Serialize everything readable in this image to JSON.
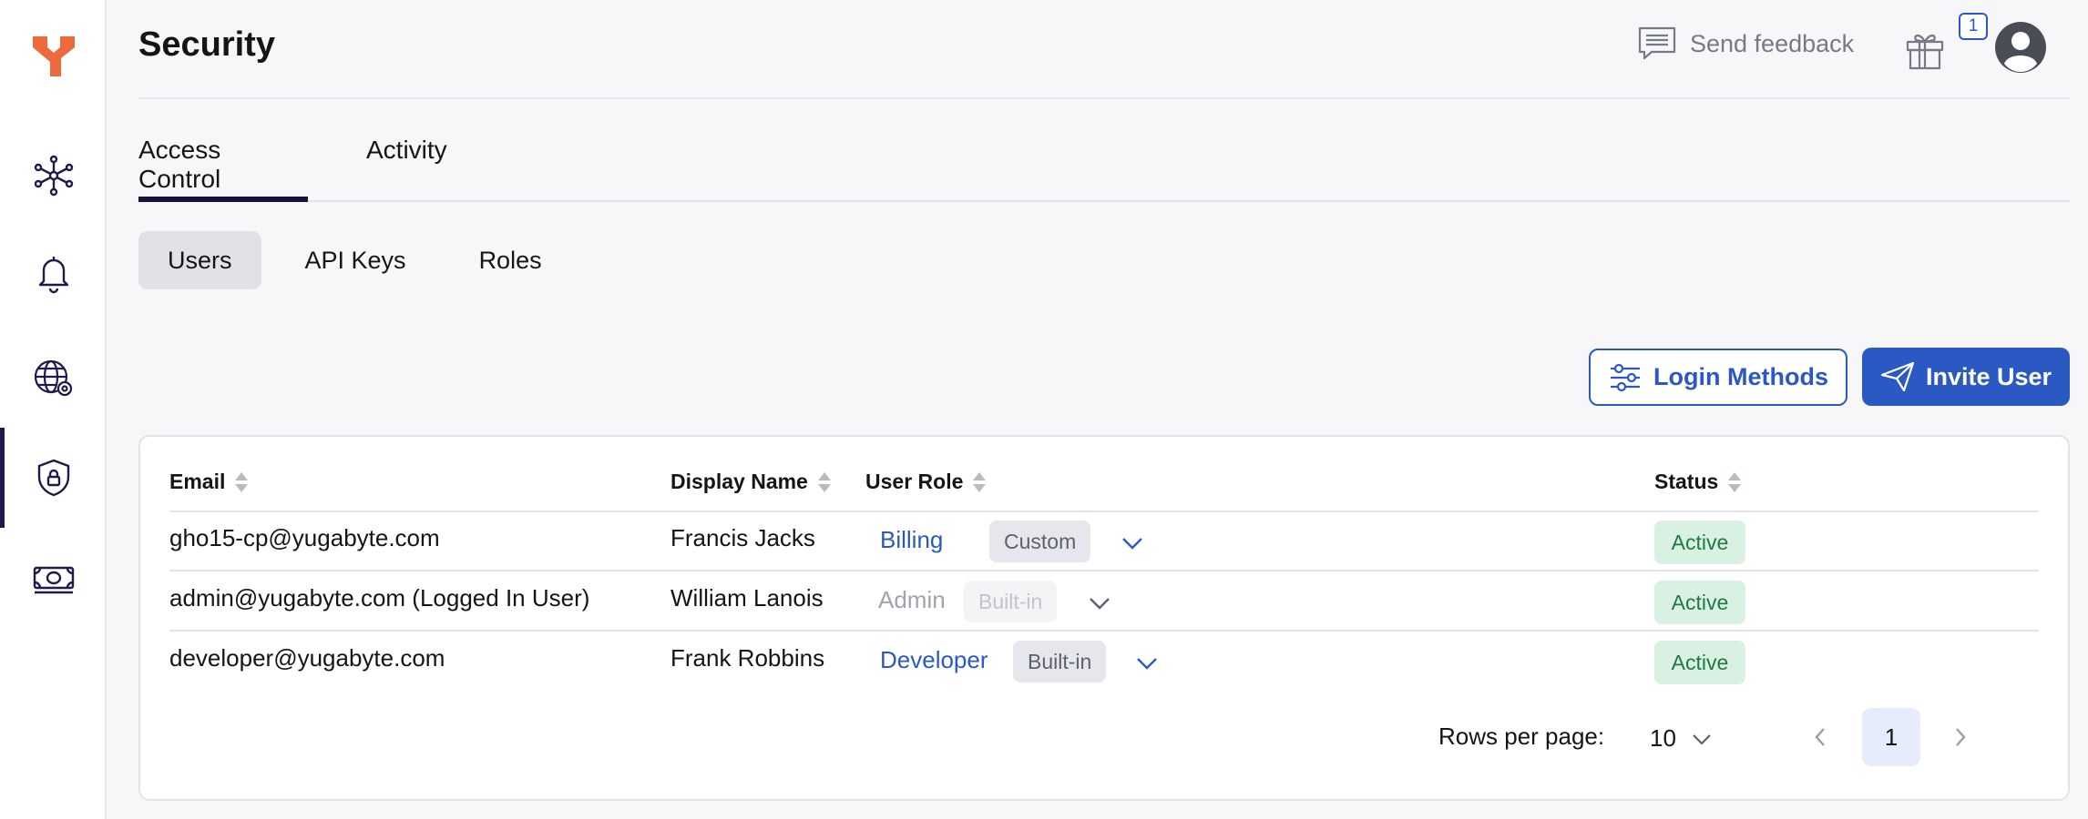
{
  "header": {
    "title": "Security",
    "feedback_label": "Send feedback",
    "notification_count": "1"
  },
  "sidebar": {
    "items": [
      {
        "name": "clusters-icon"
      },
      {
        "name": "alerts-bell-icon"
      },
      {
        "name": "networking-globe-icon"
      },
      {
        "name": "security-shield-icon"
      },
      {
        "name": "billing-money-icon"
      }
    ]
  },
  "tabs": [
    {
      "label": "Access Control",
      "active": true
    },
    {
      "label": "Activity",
      "active": false
    }
  ],
  "subtabs": [
    {
      "label": "Users",
      "active": true
    },
    {
      "label": "API Keys",
      "active": false
    },
    {
      "label": "Roles",
      "active": false
    }
  ],
  "actions": {
    "login_methods": "Login Methods",
    "invite_user": "Invite User"
  },
  "table": {
    "columns": [
      "Email",
      "Display Name",
      "User Role",
      "Status"
    ],
    "rows": [
      {
        "email": "gho15-cp@yugabyte.com",
        "display_name": "Francis Jacks",
        "role": "Billing",
        "role_type": "Custom",
        "status": "Active",
        "disabled": false
      },
      {
        "email": "admin@yugabyte.com (Logged In User)",
        "display_name": "William Lanois",
        "role": "Admin",
        "role_type": "Built-in",
        "status": "Active",
        "disabled": true
      },
      {
        "email": "developer@yugabyte.com",
        "display_name": "Frank Robbins",
        "role": "Developer",
        "role_type": "Built-in",
        "status": "Active",
        "disabled": false
      }
    ]
  },
  "pagination": {
    "rows_per_page_label": "Rows per page:",
    "rows_per_page": "10",
    "current_page": "1"
  },
  "colors": {
    "accent": "#2b59c3",
    "brand": "#e8643b",
    "active_status_bg": "#d9f1e2",
    "active_status_text": "#1f7a42"
  }
}
